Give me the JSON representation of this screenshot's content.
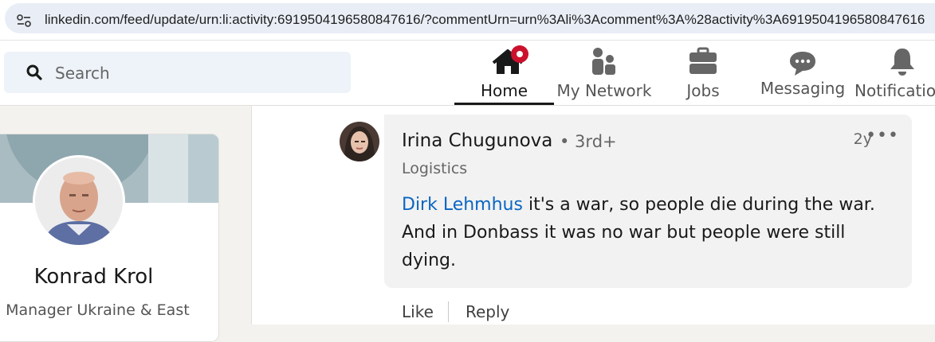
{
  "browser": {
    "url": "linkedin.com/feed/update/urn:li:activity:6919504196580847616/?commentUrn=urn%3Ali%3Acomment%3A%28activity%3A6919504196580847616"
  },
  "nav": {
    "search": {
      "placeholder": "Search"
    },
    "items": [
      {
        "label": "Home",
        "icon": "home-icon",
        "active": true,
        "badge": true
      },
      {
        "label": "My Network",
        "icon": "network-icon"
      },
      {
        "label": "Jobs",
        "icon": "briefcase-icon"
      },
      {
        "label": "Messaging",
        "icon": "messaging-icon"
      },
      {
        "label": "Notifications",
        "icon": "bell-icon"
      }
    ]
  },
  "profile": {
    "name": "Konrad Krol",
    "headline": "n Manager Ukraine & East"
  },
  "comment": {
    "author": "Irina Chugunova",
    "degree": "• 3rd+",
    "time": "2y",
    "subtitle": "Logistics",
    "mention": "Dirk Lehmhus",
    "text": " it's a war, so people die during the war. And in Donbass it was no war but people were still dying.",
    "actions": {
      "like": "Like",
      "reply": "Reply"
    }
  },
  "colors": {
    "accent": "#0a66c2",
    "badge": "#cb112d",
    "banner": "#a9bcc2"
  }
}
